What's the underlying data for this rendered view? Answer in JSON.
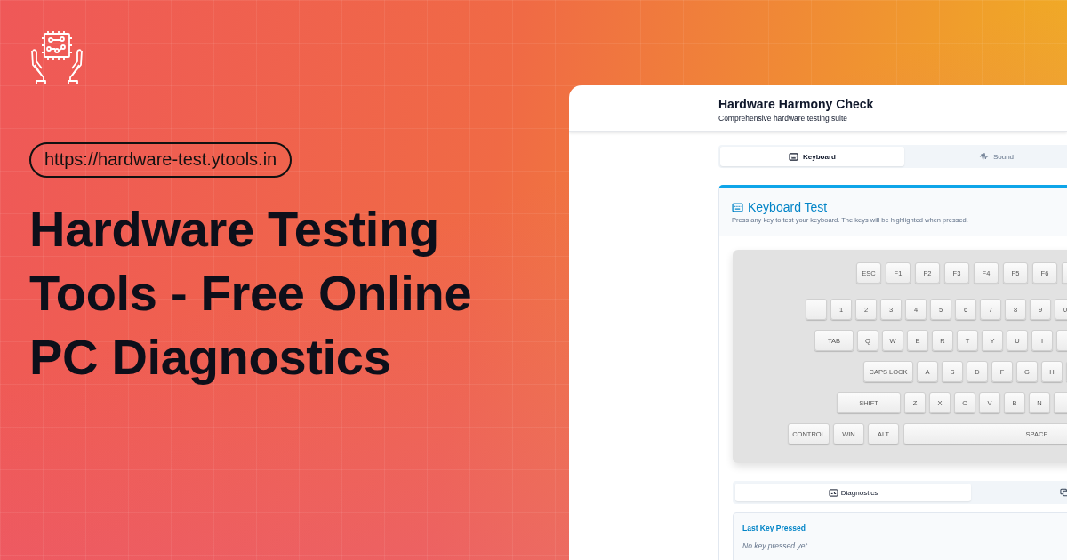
{
  "promo": {
    "url": "https://hardware-test.ytools.in",
    "headline": "Hardware Testing Tools - Free Online PC Diagnostics"
  },
  "app": {
    "title": "Hardware Harmony Check",
    "subtitle": "Comprehensive hardware testing suite",
    "tabs": [
      {
        "label": "Keyboard",
        "kind": "keyboard",
        "selected": true
      },
      {
        "label": "Sound",
        "kind": "sound",
        "selected": false
      }
    ],
    "card": {
      "title": "Keyboard Test",
      "description": "Press any key to test your keyboard. The keys will be highlighted when pressed."
    },
    "keyboard": {
      "rows": [
        {
          "keys": [
            {
              "kind": "fn",
              "label": "ESC"
            },
            {
              "kind": "fn",
              "label": "F1"
            },
            {
              "kind": "fn",
              "label": "F2"
            },
            {
              "kind": "fn",
              "label": "F3"
            },
            {
              "kind": "fn",
              "label": "F4"
            },
            {
              "kind": "fn",
              "label": "F5"
            },
            {
              "kind": "fn",
              "label": "F6"
            },
            {
              "kind": "blank"
            }
          ]
        },
        {
          "keys": [
            {
              "kind": "char",
              "label": "`"
            },
            {
              "kind": "char",
              "label": "1"
            },
            {
              "kind": "char",
              "label": "2"
            },
            {
              "kind": "char",
              "label": "3"
            },
            {
              "kind": "char",
              "label": "4"
            },
            {
              "kind": "char",
              "label": "5"
            },
            {
              "kind": "char",
              "label": "6"
            },
            {
              "kind": "char",
              "label": "7"
            },
            {
              "kind": "char",
              "label": "8"
            },
            {
              "kind": "char",
              "label": "9"
            },
            {
              "kind": "char",
              "label": "0"
            }
          ]
        },
        {
          "keys": [
            {
              "kind": "tab",
              "label": "TAB"
            },
            {
              "kind": "char",
              "label": "Q"
            },
            {
              "kind": "char",
              "label": "W"
            },
            {
              "kind": "char",
              "label": "E"
            },
            {
              "kind": "char",
              "label": "R"
            },
            {
              "kind": "char",
              "label": "T"
            },
            {
              "kind": "char",
              "label": "Y"
            },
            {
              "kind": "char",
              "label": "U"
            },
            {
              "kind": "char",
              "label": "I"
            },
            {
              "kind": "blank"
            }
          ]
        },
        {
          "keys": [
            {
              "kind": "caps",
              "label": "CAPS LOCK"
            },
            {
              "kind": "char",
              "label": "A"
            },
            {
              "kind": "char",
              "label": "S"
            },
            {
              "kind": "char",
              "label": "D"
            },
            {
              "kind": "char",
              "label": "F"
            },
            {
              "kind": "char",
              "label": "G"
            },
            {
              "kind": "char",
              "label": "H"
            },
            {
              "kind": "blank"
            }
          ]
        },
        {
          "keys": [
            {
              "kind": "shift",
              "label": "SHIFT"
            },
            {
              "kind": "char",
              "label": "Z"
            },
            {
              "kind": "char",
              "label": "X"
            },
            {
              "kind": "char",
              "label": "C"
            },
            {
              "kind": "char",
              "label": "V"
            },
            {
              "kind": "char",
              "label": "B"
            },
            {
              "kind": "char",
              "label": "N"
            },
            {
              "kind": "blank"
            }
          ]
        },
        {
          "keys": [
            {
              "kind": "control",
              "label": "CONTROL"
            },
            {
              "kind": "win",
              "label": "WIN"
            },
            {
              "kind": "alt",
              "label": "ALT"
            },
            {
              "kind": "space",
              "label": "SPACE"
            }
          ]
        }
      ]
    },
    "result_tabs": [
      {
        "label": "Diagnostics",
        "kind": "diagnostics",
        "selected": true
      },
      {
        "kind": "compare",
        "selected": false
      }
    ],
    "last_key": {
      "title": "Last Key Pressed",
      "value": "No key pressed yet"
    }
  }
}
